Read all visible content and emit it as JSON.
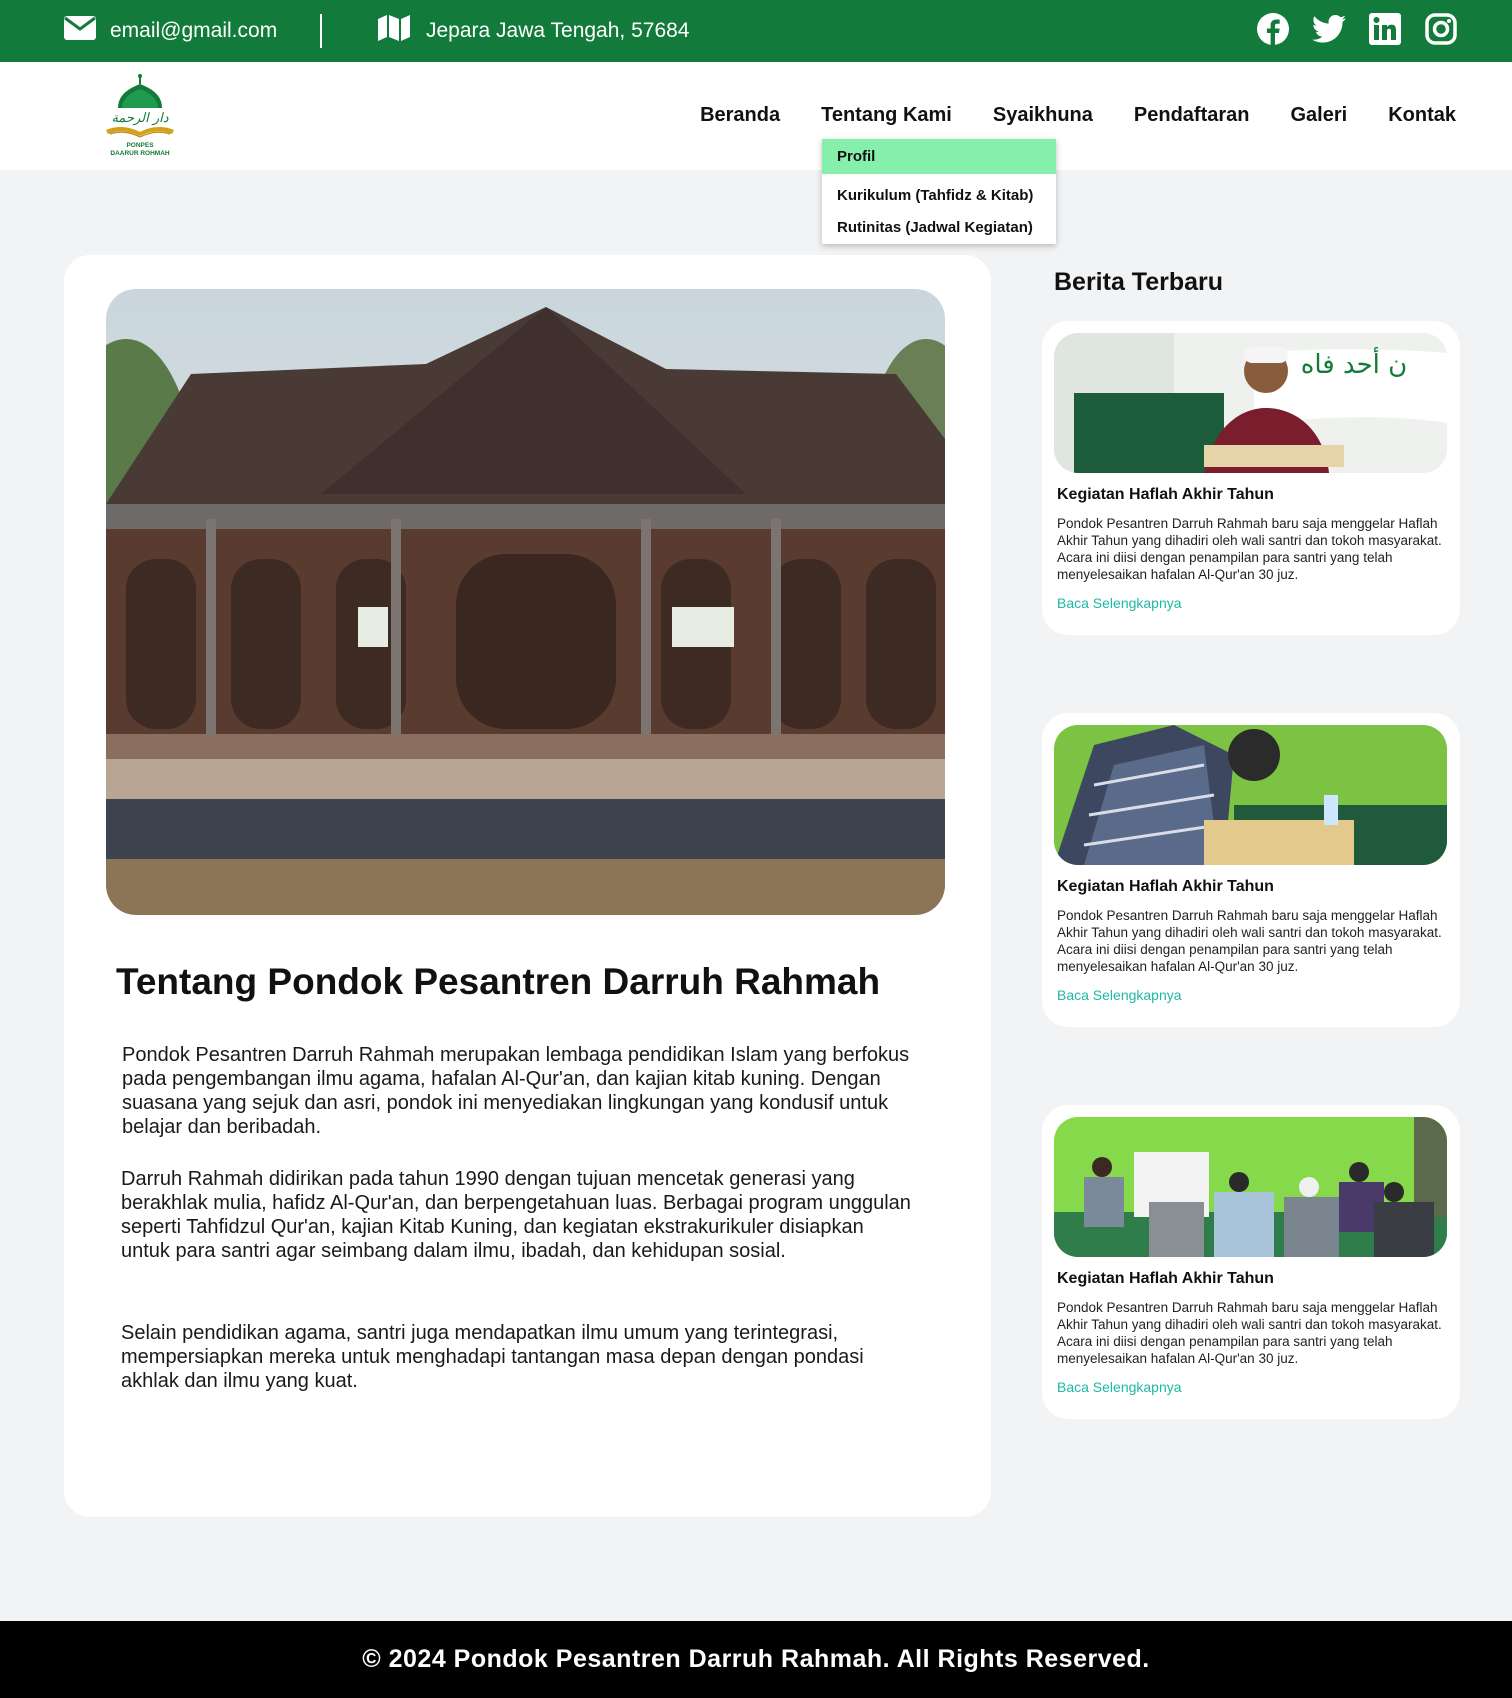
{
  "topbar": {
    "email": "email@gmail.com",
    "address": "Jepara Jawa Tengah, 57684",
    "icons": [
      "envelope-icon",
      "map-icon",
      "facebook-icon",
      "twitter-icon",
      "linkedin-icon",
      "instagram-icon"
    ]
  },
  "logo": {
    "text_line1": "PONPES",
    "text_line2": "DAARUR ROHMAH",
    "arabic": "دار الرحمة"
  },
  "nav": {
    "items": [
      "Beranda",
      "Tentang Kami",
      "Syaikhuna",
      "Pendaftaran",
      "Galeri",
      "Kontak"
    ]
  },
  "dropdown": {
    "items": [
      "Profil",
      "Kurikulum (Tahfidz & Kitab)",
      "Rutinitas (Jadwal Kegiatan)"
    ],
    "active_color": "#86efac"
  },
  "main": {
    "title": "Tentang Pondok Pesantren Darruh Rahmah",
    "paragraphs": [
      "Pondok Pesantren Darruh Rahmah merupakan lembaga pendidikan Islam yang berfokus pada pengembangan ilmu agama, hafalan Al-Qur'an, dan kajian kitab kuning. Dengan suasana yang sejuk dan asri, pondok ini menyediakan lingkungan yang kondusif untuk belajar dan beribadah.",
      "Darruh Rahmah didirikan pada tahun 1990 dengan tujuan mencetak generasi yang berakhlak mulia, hafidz Al-Qur'an, dan berpengetahuan luas. Berbagai program unggulan seperti Tahfidzul Qur'an, kajian Kitab Kuning, dan kegiatan ekstrakurikuler disiapkan untuk para santri agar seimbang dalam ilmu, ibadah, dan kehidupan sosial.",
      "Selain pendidikan agama, santri juga mendapatkan ilmu umum yang terintegrasi, mempersiapkan mereka untuk menghadapi tantangan masa depan dengan pondasi akhlak dan ilmu yang kuat."
    ]
  },
  "sidebar": {
    "title": "Berita Terbaru",
    "news": [
      {
        "title": "Kegiatan Haflah Akhir Tahun",
        "desc": "Pondok Pesantren Darruh Rahmah baru saja menggelar Haflah Akhir Tahun yang dihadiri oleh wali santri dan tokoh masyarakat. Acara ini diisi dengan penampilan para santri yang telah menyelesaikan hafalan Al-Qur'an 30 juz.",
        "link": "Baca Selengkapnya"
      },
      {
        "title": "Kegiatan Haflah Akhir Tahun",
        "desc": "Pondok Pesantren Darruh Rahmah baru saja menggelar Haflah Akhir Tahun yang dihadiri oleh wali santri dan tokoh masyarakat. Acara ini diisi dengan penampilan para santri yang telah menyelesaikan hafalan Al-Qur'an 30 juz.",
        "link": "Baca Selengkapnya"
      },
      {
        "title": "Kegiatan Haflah Akhir Tahun",
        "desc": "Pondok Pesantren Darruh Rahmah baru saja menggelar Haflah Akhir Tahun yang dihadiri oleh wali santri dan tokoh masyarakat. Acara ini diisi dengan penampilan para santri yang telah menyelesaikan hafalan Al-Qur'an 30 juz.",
        "link": "Baca Selengkapnya"
      }
    ]
  },
  "footer": {
    "text": "© 2024 Pondok Pesantren Darruh Rahmah. All Rights Reserved."
  },
  "colors": {
    "topbar": "#127a3a",
    "link": "#1fb7a3",
    "page_bg": "#f2f3f5",
    "footer": "#000000"
  }
}
